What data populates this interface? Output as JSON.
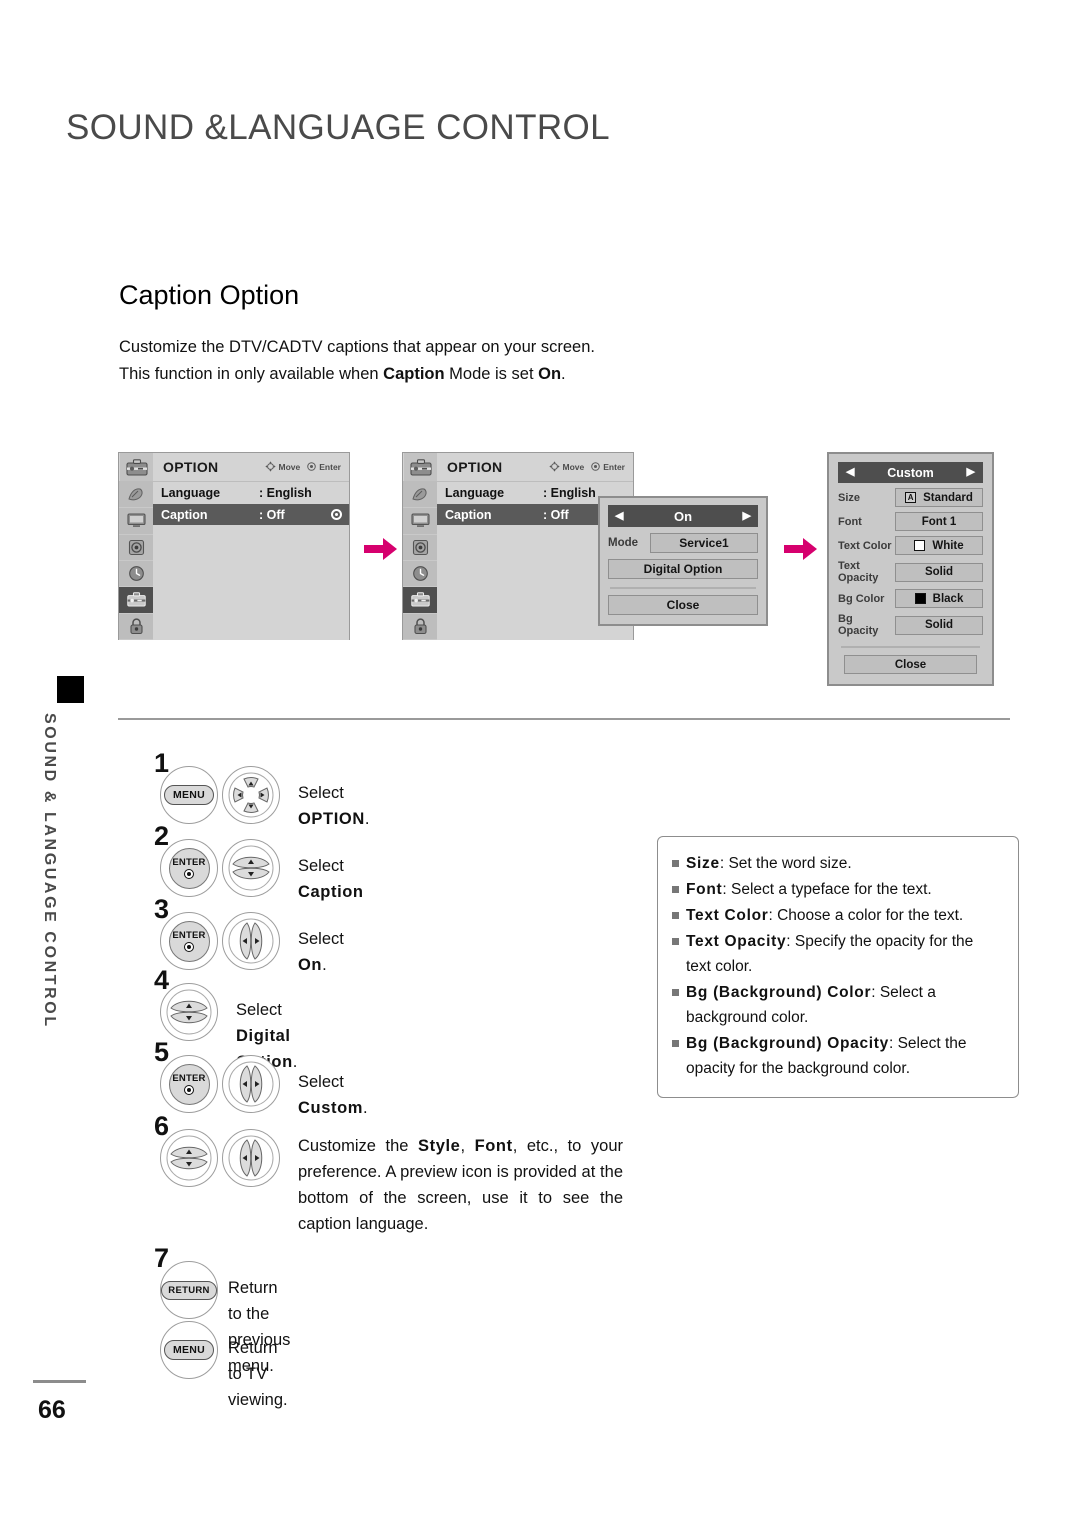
{
  "header": {
    "title": "SOUND &LANGUAGE CONTROL"
  },
  "side_tab": {
    "label": "SOUND & LANGUAGE CONTROL"
  },
  "footer": {
    "page_number": "66"
  },
  "section": {
    "title": "Caption Option",
    "intro_line1": "Customize the DTV/CADTV captions that appear on your screen.",
    "intro_line2_a": "This function in only available when ",
    "intro_line2_b": "Caption",
    "intro_line2_c": " Mode is set ",
    "intro_line2_d": "On",
    "intro_line2_e": "."
  },
  "osd": {
    "title": "OPTION",
    "hint_move": "Move",
    "hint_enter": "Enter",
    "rows": [
      {
        "label": "Language",
        "value": ": English"
      },
      {
        "label": "Caption",
        "value": ": Off"
      }
    ]
  },
  "popup": {
    "state": "On",
    "mode_label": "Mode",
    "mode_value": "Service1",
    "digital_option": "Digital Option",
    "close": "Close"
  },
  "custom": {
    "title": "Custom",
    "rows": [
      {
        "label": "Size",
        "value": "Standard",
        "swatch": "letter-a",
        "swatch_color": ""
      },
      {
        "label": "Font",
        "value": "Font 1",
        "swatch": "none",
        "swatch_color": ""
      },
      {
        "label": "Text Color",
        "value": "White",
        "swatch": "box",
        "swatch_color": "#ffffff"
      },
      {
        "label": "Text Opacity",
        "value": "Solid",
        "swatch": "none",
        "swatch_color": ""
      },
      {
        "label": "Bg Color",
        "value": "Black",
        "swatch": "box",
        "swatch_color": "#000000"
      },
      {
        "label": "Bg Opacity",
        "value": "Solid",
        "swatch": "none",
        "swatch_color": ""
      }
    ],
    "close": "Close"
  },
  "arrow_color": "#D6006E",
  "steps": [
    {
      "num": "1",
      "buttons": [
        "menu-pill",
        "dpad-4way"
      ],
      "text_pre": "Select ",
      "text_bold": "OPTION",
      "text_post": "."
    },
    {
      "num": "2",
      "buttons": [
        "enter-knob",
        "dpad-updown"
      ],
      "text_pre": "Select ",
      "text_bold": "Caption",
      "text_post": ""
    },
    {
      "num": "3",
      "buttons": [
        "enter-knob",
        "dpad-leftright"
      ],
      "text_pre": "Select ",
      "text_bold": "On",
      "text_post": "."
    },
    {
      "num": "4",
      "buttons": [
        "dpad-updown"
      ],
      "text_pre": "Select ",
      "text_bold": "Digital Option",
      "text_post": "."
    },
    {
      "num": "5",
      "buttons": [
        "enter-knob",
        "dpad-leftright"
      ],
      "text_pre": "Select ",
      "text_bold": "Custom",
      "text_post": "."
    },
    {
      "num": "6",
      "buttons": [
        "dpad-updown",
        "dpad-leftright"
      ],
      "text_pre": "Customize the ",
      "text_bold": "Style",
      "text_mid": ", ",
      "text_bold2": "Font",
      "text_post": ", etc., to your preference. A preview icon is provided at the bottom of the screen, use it to see the caption language."
    },
    {
      "num": "7",
      "buttons": [
        "return-pill"
      ],
      "text_pre": "Return to the previous menu.",
      "text_bold": "",
      "text_post": ""
    }
  ],
  "step_button_labels": {
    "menu": "MENU",
    "enter": "ENTER",
    "return": "RETURN"
  },
  "final_step": {
    "button": "MENU",
    "text": "Return to TV viewing."
  },
  "info": {
    "items": [
      {
        "term": "Size",
        "desc": ": Set the word size."
      },
      {
        "term": "Font",
        "desc": ": Select a typeface for the text."
      },
      {
        "term": "Text Color",
        "desc": ": Choose a color for the text."
      },
      {
        "term": "Text Opacity",
        "desc": ": Specify the opacity for the text color."
      },
      {
        "term": "Bg (Background) Color",
        "desc": ": Select a background color."
      },
      {
        "term": "Bg (Background) Opacity",
        "desc": ": Select the opacity for the background color."
      }
    ]
  }
}
